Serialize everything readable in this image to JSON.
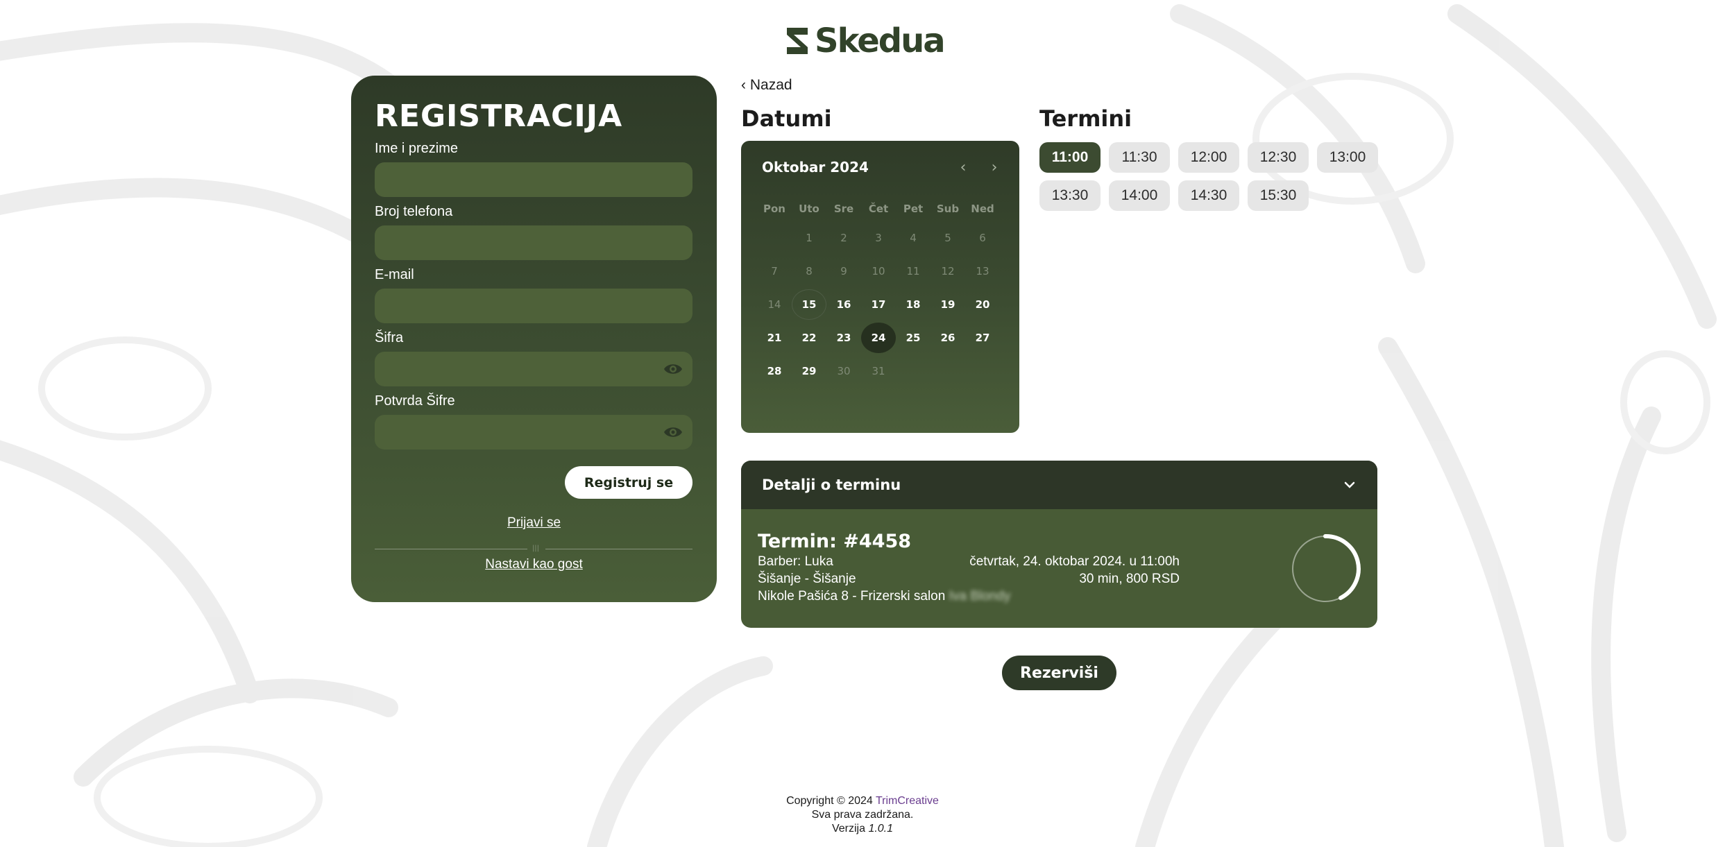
{
  "brand": {
    "name": "Skedua",
    "logo_icon": "skedua-s-logo-icon"
  },
  "registration": {
    "title": "REGISTRACIJA",
    "fields": [
      {
        "label": "Ime i prezime",
        "value": "",
        "type": "text"
      },
      {
        "label": "Broj telefona",
        "value": "",
        "type": "tel"
      },
      {
        "label": "E-mail",
        "value": "",
        "type": "email"
      },
      {
        "label": "Šifra",
        "value": "",
        "type": "password",
        "icon": "eye-icon"
      },
      {
        "label": "Potvrda Šifre",
        "value": "",
        "type": "password",
        "icon": "eye-icon"
      }
    ],
    "submit_label": "Registruj se",
    "login_link": "Prijavi se",
    "guest_link": "Nastavi kao gost"
  },
  "back_label": "Nazad",
  "dates_title": "Datumi",
  "times_title": "Termini",
  "calendar": {
    "month_label": "Oktobar 2024",
    "weekdays": [
      "Pon",
      "Uto",
      "Sre",
      "Čet",
      "Pet",
      "Sub",
      "Ned"
    ],
    "weeks": [
      [
        "",
        "1",
        "2",
        "3",
        "4",
        "5",
        "6"
      ],
      [
        "7",
        "8",
        "9",
        "10",
        "11",
        "12",
        "13"
      ],
      [
        "14",
        "15",
        "16",
        "17",
        "18",
        "19",
        "20"
      ],
      [
        "21",
        "22",
        "23",
        "24",
        "25",
        "26",
        "27"
      ],
      [
        "28",
        "29",
        "30",
        "31",
        "",
        "",
        ""
      ]
    ],
    "first_available_day": 15,
    "last_available_day": 29,
    "today": 15,
    "selected": 24
  },
  "time_slots": {
    "rows": [
      [
        "11:00",
        "11:30",
        "12:00",
        "12:30",
        "13:00"
      ],
      [
        "13:30",
        "14:00",
        "14:30",
        "15:30"
      ]
    ],
    "selected": "11:00"
  },
  "details": {
    "header": "Detalji o terminu",
    "term_number": "Termin: #4458",
    "barber": "Barber: Luka",
    "service": "Šišanje - Šišanje",
    "address": "Nikole Pašića 8 - Frizerski salon",
    "salon_name_blurred": "Iva Blondy",
    "datetime": "četvrtak, 24. oktobar 2024. u 11:00h",
    "duration_price": "30 min, 800 RSD"
  },
  "reserve_label": "Rezerviši",
  "footer": {
    "copyright": "Copyright © 2024",
    "company": "TrimCreative",
    "rights": "Sva prava zadržana.",
    "version_prefix": "Verzija",
    "version": "1.0.1"
  },
  "colors": {
    "primary_green": "#3c4b31",
    "dark_green": "#2d3627",
    "link_purple": "#6a3d8f"
  }
}
